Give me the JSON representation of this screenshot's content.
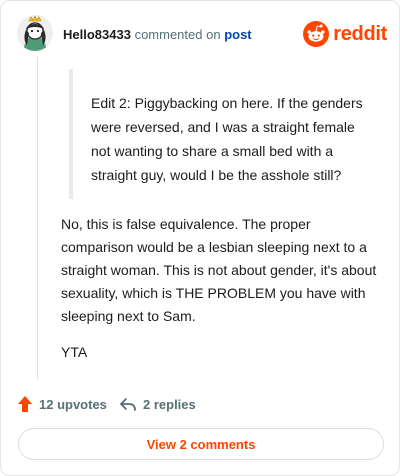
{
  "comment": {
    "username": "Hello83433",
    "action_text": "commented on",
    "post_link": "post",
    "brand": "reddit",
    "avatar_icon": "snoo-avatar-icon",
    "quote": "Edit 2: Piggybacking on here. If the genders were reversed, and I was a straight female not wanting to share a small bed with a straight guy, would I be the asshole still?",
    "paragraphs": [
      "No, this is false equivalence. The proper comparison would be a lesbian sleeping next to a straight woman. This is not about gender, it's about sexuality, which is THE PROBLEM you have with sleeping next to Sam.",
      "YTA"
    ]
  },
  "actions": {
    "upvotes": "12 upvotes",
    "replies": "2 replies",
    "upvote_icon": "upvote-arrow-icon",
    "reply_icon": "reply-arrow-icon"
  },
  "footer": {
    "view_comments": "View 2 comments"
  },
  "colors": {
    "accent": "#ff4500",
    "link": "#0045ac",
    "muted": "#576f76"
  }
}
